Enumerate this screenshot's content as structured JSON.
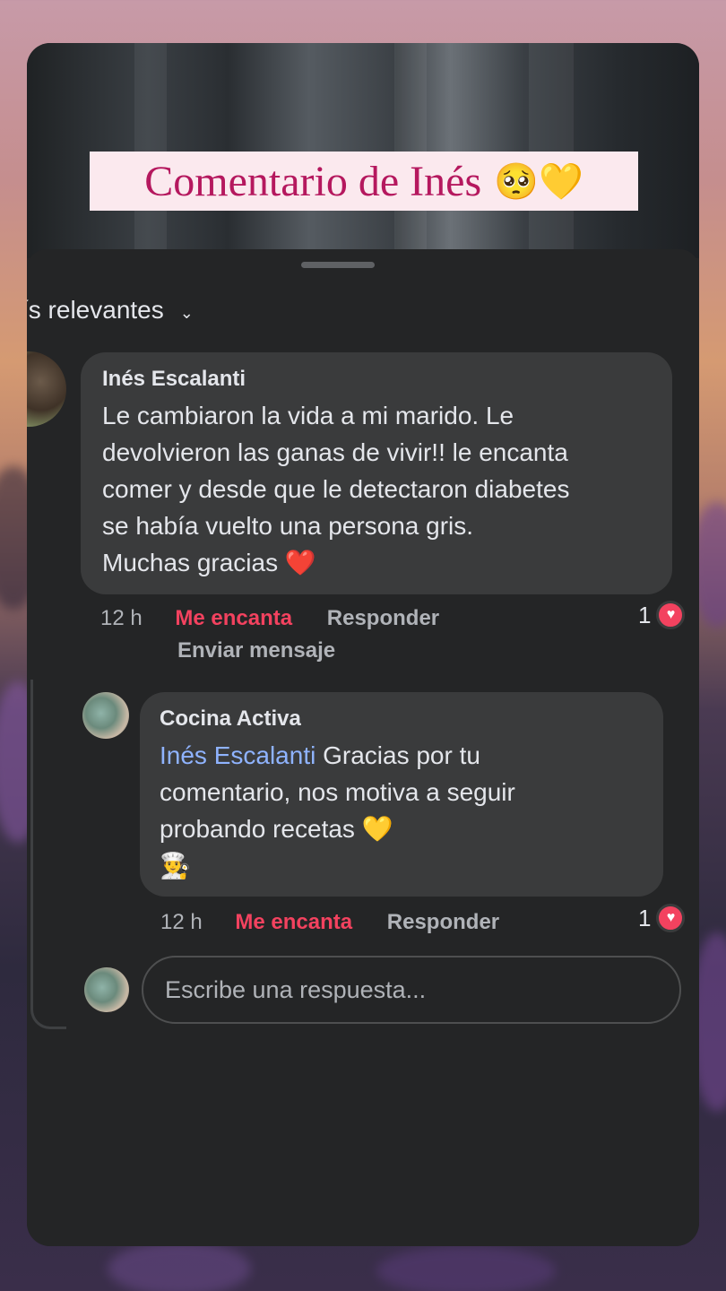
{
  "banner": {
    "title": "Comentario de Inés",
    "emoji": "🥺💛"
  },
  "sort": {
    "label": "ís relevantes",
    "chevron": "⌄"
  },
  "comment": {
    "author": "Inés Escalanti",
    "lines": [
      "Le cambiaron la vida a mi marido. Le",
      "devolvieron las ganas de vivir!! le encanta",
      "comer y desde que le detectaron diabetes",
      "se había vuelto una persona gris.",
      "Muchas gracias ❤️"
    ],
    "time": "12 h",
    "reaction": "Me encanta",
    "reply": "Responder",
    "send_message": "Enviar mensaje",
    "reaction_count": "1"
  },
  "reply_comment": {
    "author": "Cocina Activa",
    "mention": "Inés Escalanti",
    "line1_rest": " Gracias por tu",
    "lines": [
      "comentario, nos motiva a seguir",
      "probando recetas 💛",
      "👨‍🍳"
    ],
    "time": "12 h",
    "reaction": "Me encanta",
    "reply": "Responder",
    "reaction_count": "1"
  },
  "reply_box": {
    "placeholder": "Escribe una respuesta..."
  },
  "icons": {
    "heart": "heart-icon",
    "chevron": "chevron-down-icon"
  },
  "colors": {
    "love": "#f3425f",
    "mention": "#8fb3ff",
    "banner_text": "#b5185e"
  }
}
